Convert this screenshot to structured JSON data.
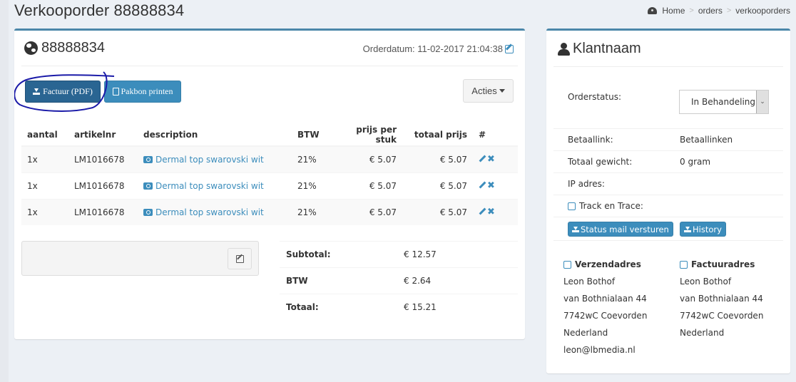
{
  "page": {
    "title": "Verkooporder 88888834",
    "breadcrumb": [
      "Home",
      "orders",
      "verkooporders"
    ]
  },
  "order": {
    "number": "88888834",
    "date_label": "Orderdatum: 11-02-2017 21:04:38",
    "buttons": {
      "factuur": "Factuur (PDF)",
      "pakbon": "Pakbon printen",
      "acties": "Acties"
    },
    "table": {
      "headers": [
        "aantal",
        "artikelnr",
        "description",
        "BTW",
        "prijs per stuk",
        "totaal prijs",
        "#"
      ],
      "rows": [
        {
          "aantal": "1x",
          "artikelnr": "LM1016678",
          "description": "Dermal top swarovski wit",
          "btw": "21%",
          "prijs": "€ 5.07",
          "totaal": "€ 5.07"
        },
        {
          "aantal": "1x",
          "artikelnr": "LM1016678",
          "description": "Dermal top swarovski wit",
          "btw": "21%",
          "prijs": "€ 5.07",
          "totaal": "€ 5.07"
        },
        {
          "aantal": "1x",
          "artikelnr": "LM1016678",
          "description": "Dermal top swarovski wit",
          "btw": "21%",
          "prijs": "€ 5.07",
          "totaal": "€ 5.07"
        }
      ]
    },
    "totals": [
      {
        "label": "Subtotal:",
        "value": "€ 12.57"
      },
      {
        "label": "BTW",
        "value": "€ 2.64"
      },
      {
        "label": "Totaal:",
        "value": "€ 15.21"
      }
    ]
  },
  "customer": {
    "title": "Klantnaam",
    "orderstatus_label": "Orderstatus:",
    "orderstatus_value": "In Behandeling",
    "betaallink_label": "Betaallink:",
    "betaallink_value": "Betaallinken",
    "gewicht_label": "Totaal gewicht:",
    "gewicht_value": "0 gram",
    "ip_label": "IP adres:",
    "ip_value": "",
    "track_label": "Track en Trace:",
    "status_mail_button": "Status mail versturen",
    "history_button": "History",
    "verzendadres": {
      "title": "Verzendadres",
      "lines": [
        "Leon Bothof",
        "van Bothnialaan 44",
        "7742wC Coevorden",
        "Nederland",
        "leon@lbmedia.nl"
      ]
    },
    "factuuradres": {
      "title": "Factuuradres",
      "lines": [
        "Leon Bothof",
        "van Bothnialaan 44",
        "7742wC Coevorden",
        "Nederland"
      ]
    }
  },
  "colors": {
    "accent": "#3c8dbc",
    "box_border": "#4b87a9",
    "primary_dark": "#2a6592",
    "background": "#ecf0f5",
    "annotation": "#1a1aa8"
  }
}
